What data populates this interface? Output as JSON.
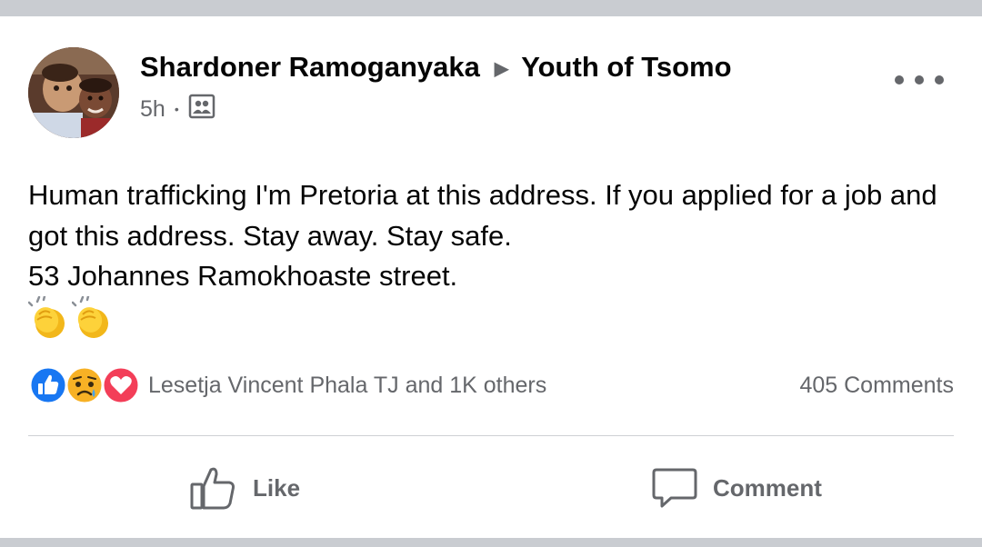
{
  "post": {
    "author": "Shardoner Ramoganyaka",
    "arrow": "▶",
    "group": "Youth of Tsomo",
    "time": "5h",
    "separator": "•",
    "audience_icon": "group-audience-icon",
    "body": {
      "line1": "Human trafficking I'm Pretoria at this address. If you applied for a job and got this address. Stay away. Stay safe.",
      "line2": "53 Johannes Ramokhoaste street."
    },
    "emojis": [
      "clapping-hands-emoji",
      "clapping-hands-emoji"
    ]
  },
  "engagement": {
    "reaction_icons": [
      "like-reaction-icon",
      "sad-reaction-icon",
      "love-reaction-icon"
    ],
    "reactors_text": "Lesetja Vincent Phala TJ and 1K others",
    "comments_text": "405 Comments"
  },
  "actions": {
    "like_label": "Like",
    "comment_label": "Comment"
  },
  "colors": {
    "text_primary": "#050505",
    "text_secondary": "#65676b",
    "like_blue": "#1877f2",
    "love_red": "#f33e58",
    "sad_yellow": "#f7b125",
    "background": "#ccd0d5"
  }
}
